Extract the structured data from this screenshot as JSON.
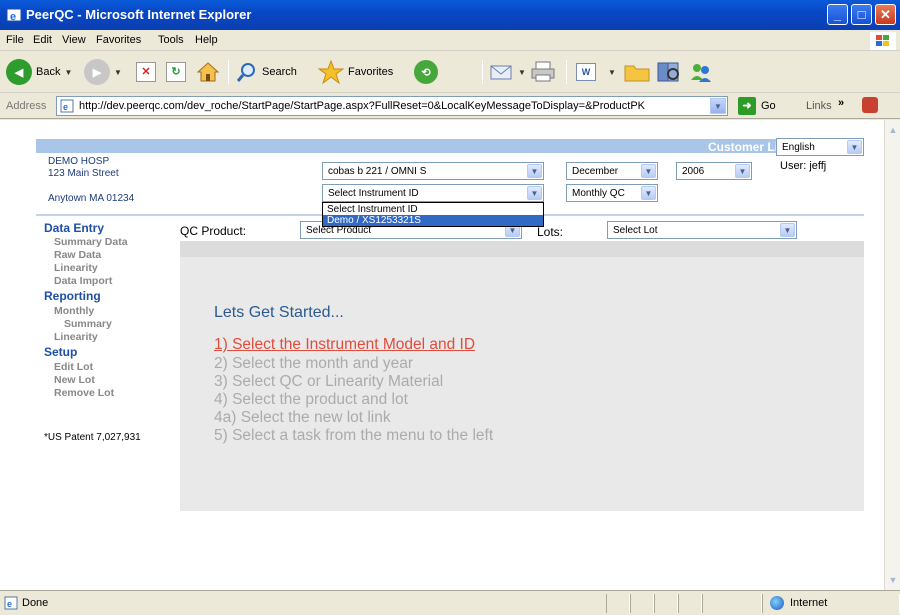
{
  "window": {
    "title": "PeerQC - Microsoft Internet Explorer"
  },
  "menu": [
    {
      "label": "File",
      "key": "F"
    },
    {
      "label": "Edit",
      "key": "E"
    },
    {
      "label": "View",
      "key": "V"
    },
    {
      "label": "Favorites",
      "key": "a"
    },
    {
      "label": "Tools",
      "key": "T"
    },
    {
      "label": "Help",
      "key": "H"
    }
  ],
  "toolbar": {
    "back_label": "Back",
    "search_label": "Search",
    "favorites_label": "Favorites"
  },
  "address": {
    "label": "Address",
    "url": "http://dev.peerqc.com/dev_roche/StartPage/StartPage.aspx?FullReset=0&LocalKeyMessageToDisplay=&ProductPK",
    "go_label": "Go",
    "links_label": "Links"
  },
  "header": {
    "customer_list": "Customer List",
    "language": "English",
    "user": "User: jeffj",
    "hospital_name": "DEMO HOSP",
    "address_line1": "123 Main Street",
    "address_line2": "Anytown MA 01234"
  },
  "filters": {
    "instrument_model": "cobas b 221 / OMNI S",
    "instrument_id": "Select Instrument ID",
    "month": "December",
    "year": "2006",
    "qc_type": "Monthly QC",
    "qc_product_label": "QC Product:",
    "qc_product": "Select Product",
    "lots_label": "Lots:",
    "lot": "Select Lot"
  },
  "instrument_dropdown": {
    "options": [
      "Select Instrument ID",
      "Demo / XS1253321S"
    ],
    "highlighted": "Demo / XS1253321S"
  },
  "nav": {
    "data_entry": "Data Entry",
    "summary_data": "Summary Data",
    "raw_data": "Raw Data",
    "linearity": "Linearity",
    "data_import": "Data Import",
    "reporting": "Reporting",
    "monthly": "Monthly",
    "summary": "Summary",
    "linearity_report": "Linearity",
    "setup": "Setup",
    "edit_lot": "Edit Lot",
    "new_lot": "New Lot",
    "remove_lot": "Remove Lot"
  },
  "patent": "*US Patent 7,027,931",
  "getting_started": {
    "title": "Lets Get Started...",
    "steps": [
      "1) Select the Instrument Model and ID",
      "2) Select the month and year",
      "3) Select QC or Linearity Material",
      "4) Select the product and lot",
      "4a) Select the new lot link",
      "5) Select a task from the menu to the left"
    ]
  },
  "status": {
    "text": "Done",
    "zone": "Internet"
  },
  "colors": {
    "titlebar": "#0a5bd9",
    "nav_heading": "#1e4fa8",
    "active_step": "#e14c3c",
    "header_band": "#a9c5e7"
  }
}
